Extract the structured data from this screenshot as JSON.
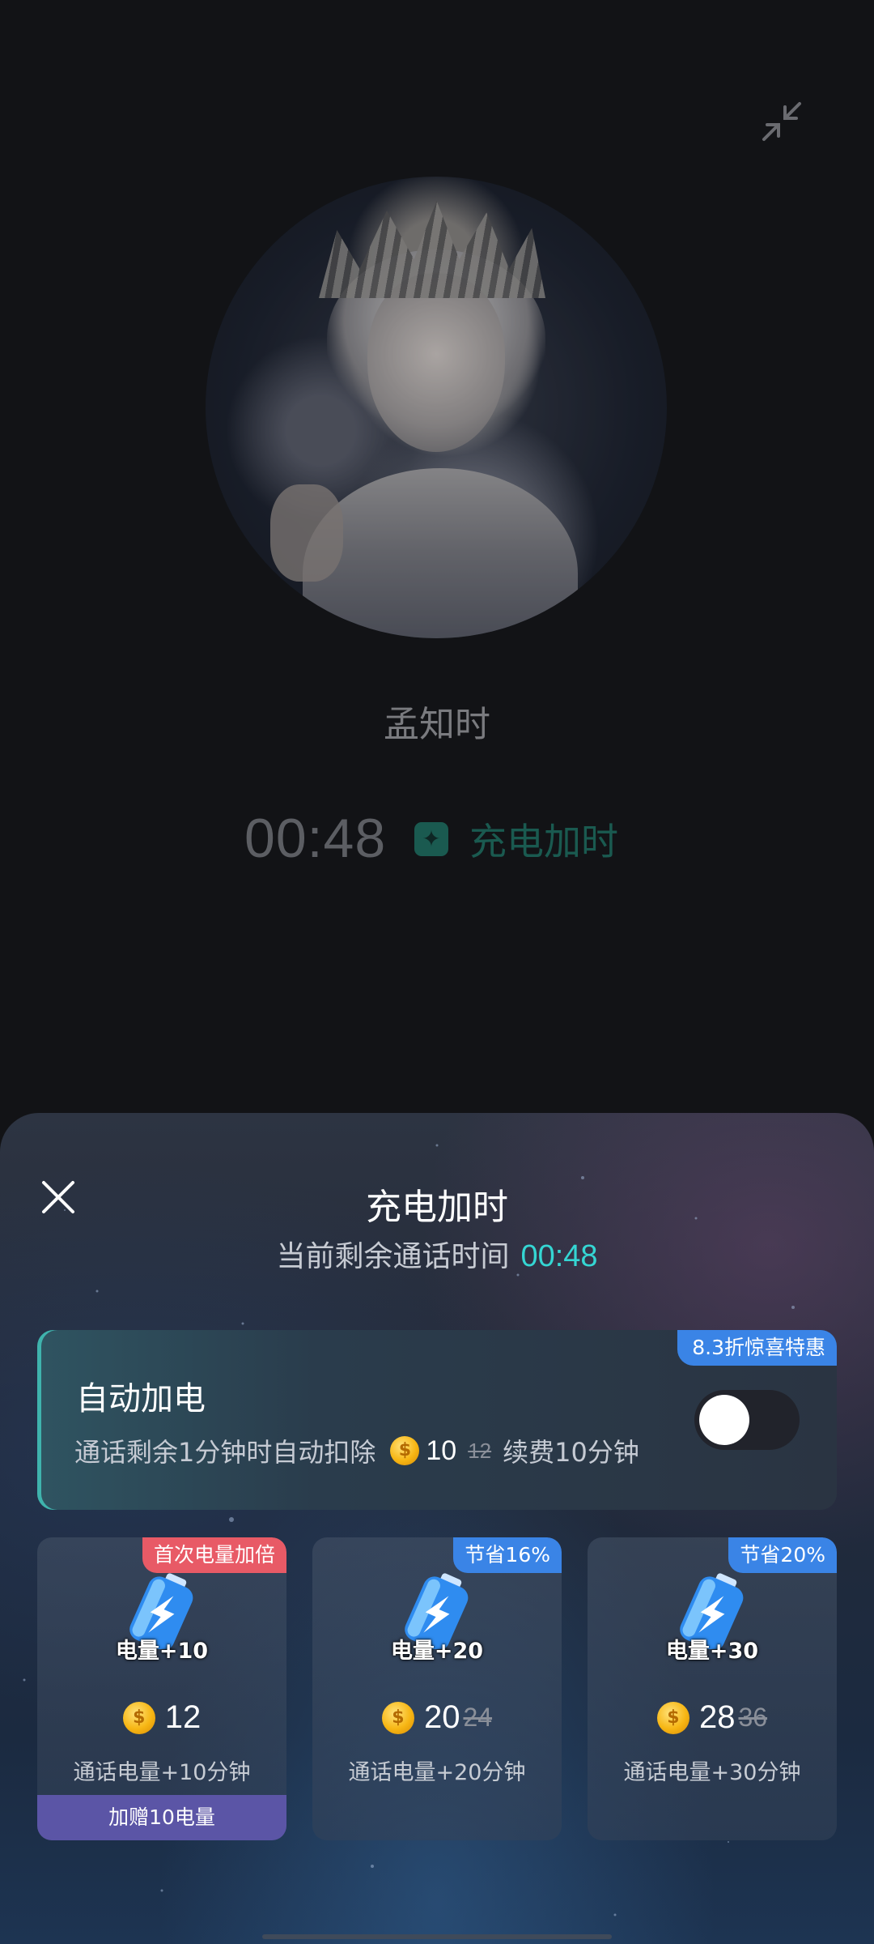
{
  "call": {
    "caller_name": "孟知时",
    "timer": "00:48",
    "charge_link": "充电加时"
  },
  "sheet": {
    "title": "充电加时",
    "remaining_label": "当前剩余通话时间",
    "remaining_time": "00:48",
    "auto_recharge": {
      "badge": "8.3折惊喜特惠",
      "title": "自动加电",
      "desc_prefix": "通话剩余1分钟时自动扣除",
      "price": "10",
      "original_price": "12",
      "desc_suffix": "续费10分钟",
      "toggle_on": false
    },
    "packages": [
      {
        "badge": "首次电量加倍",
        "badge_color": "#e85a66",
        "amount": "电量+10",
        "price": "12",
        "original_price": "",
        "desc": "通话电量+10分钟",
        "bonus": "加赠10电量"
      },
      {
        "badge": "节省16%",
        "badge_color": "#3a84e6",
        "amount": "电量+20",
        "price": "20",
        "original_price": "24",
        "desc": "通话电量+20分钟",
        "bonus": ""
      },
      {
        "badge": "节省20%",
        "badge_color": "#3a84e6",
        "amount": "电量+30",
        "price": "28",
        "original_price": "36",
        "desc": "通话电量+30分钟",
        "bonus": ""
      }
    ]
  },
  "icons": {
    "minimize": "minimize-arrows-icon",
    "close": "close-icon",
    "spark": "sparkle-icon",
    "coin": "coin-icon",
    "battery": "battery-bolt-icon"
  },
  "colors": {
    "accent_teal": "#35d6d3",
    "badge_blue": "#3a84e6",
    "badge_red": "#e85a66",
    "bonus_purple": "#5b55a6"
  }
}
